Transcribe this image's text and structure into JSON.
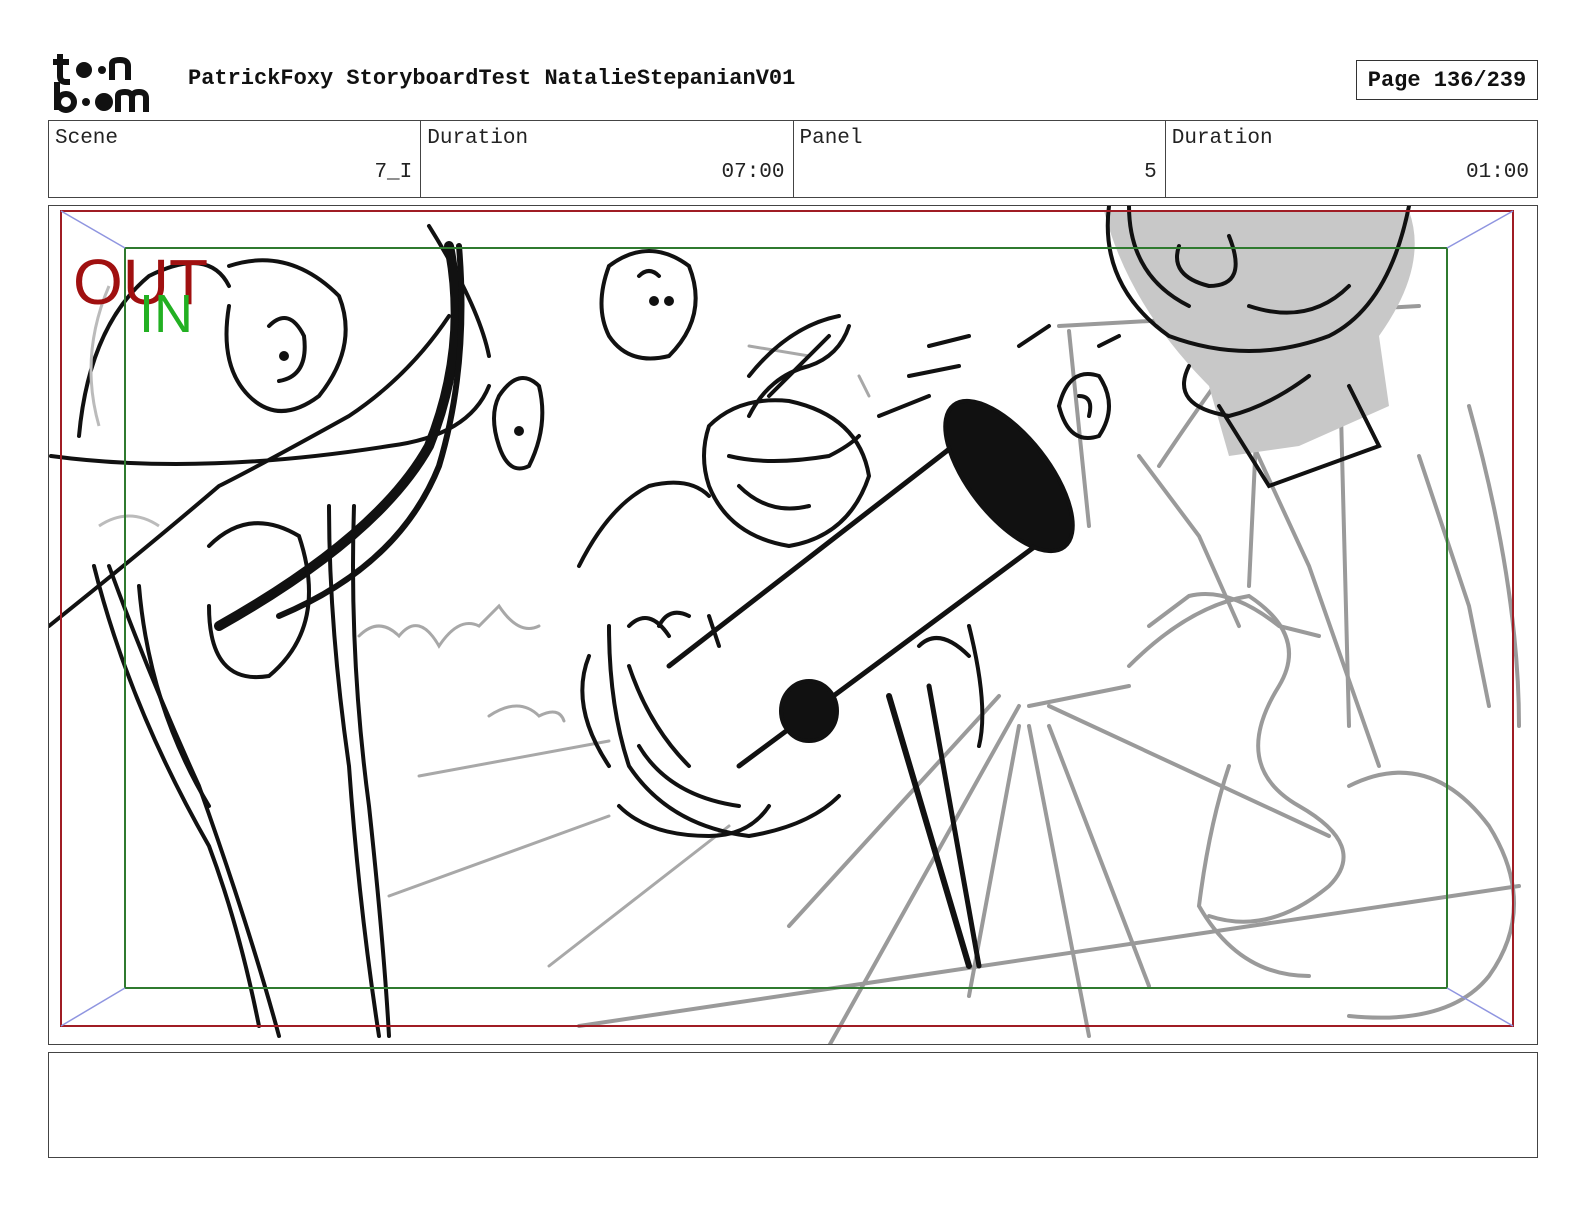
{
  "header": {
    "logo_text": "toon boom",
    "title": "PatrickFoxy StoryboardTest NatalieStepanianV01",
    "page": "Page 136/239"
  },
  "info": {
    "scene_label": "Scene",
    "scene_value": "7_I",
    "scene_duration_label": "Duration",
    "scene_duration_value": "07:00",
    "panel_label": "Panel",
    "panel_value": "5",
    "panel_duration_label": "Duration",
    "panel_duration_value": "01:00"
  },
  "panel": {
    "out_label": "OUT",
    "in_label": "IN",
    "colors": {
      "out_frame": "#a01c24",
      "in_frame": "#2f7a2f",
      "out_text": "#a01010",
      "in_text": "#22b022"
    }
  },
  "notes": {
    "text": ""
  }
}
